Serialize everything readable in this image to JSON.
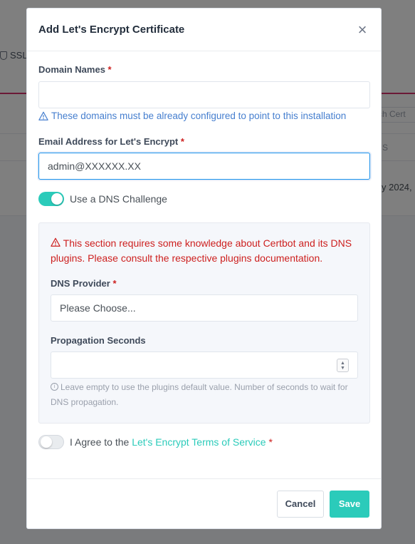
{
  "background": {
    "nav_item_label": "SSL",
    "search_placeholder": "rch Cert",
    "column_header_fragment": "S",
    "date_fragment": "y 2024,"
  },
  "modal": {
    "title": "Add Let's Encrypt Certificate",
    "close_symbol": "×",
    "domain_names": {
      "label": "Domain Names",
      "required_mark": "*",
      "value": "",
      "hint": "These domains must be already configured to point to this installation"
    },
    "email": {
      "label": "Email Address for Let's Encrypt",
      "required_mark": "*",
      "value": "admin@XXXXXX.XX"
    },
    "dns_challenge": {
      "label": "Use a DNS Challenge",
      "enabled": true
    },
    "dns_section": {
      "warning": "This section requires some knowledge about Certbot and its DNS plugins. Please consult the respective plugins documentation.",
      "provider": {
        "label": "DNS Provider",
        "required_mark": "*",
        "selected": "Please Choose..."
      },
      "propagation": {
        "label": "Propagation Seconds",
        "value": "",
        "help": "Leave empty to use the plugins default value. Number of seconds to wait for DNS propagation."
      }
    },
    "tos": {
      "prefix": "I Agree to the",
      "link_text": "Let's Encrypt Terms of Service",
      "required_mark": "*",
      "agreed": false
    },
    "footer": {
      "cancel_label": "Cancel",
      "save_label": "Save"
    }
  },
  "colors": {
    "accent": "#2bcbba",
    "info": "#467fcf",
    "danger": "#cd201f"
  }
}
